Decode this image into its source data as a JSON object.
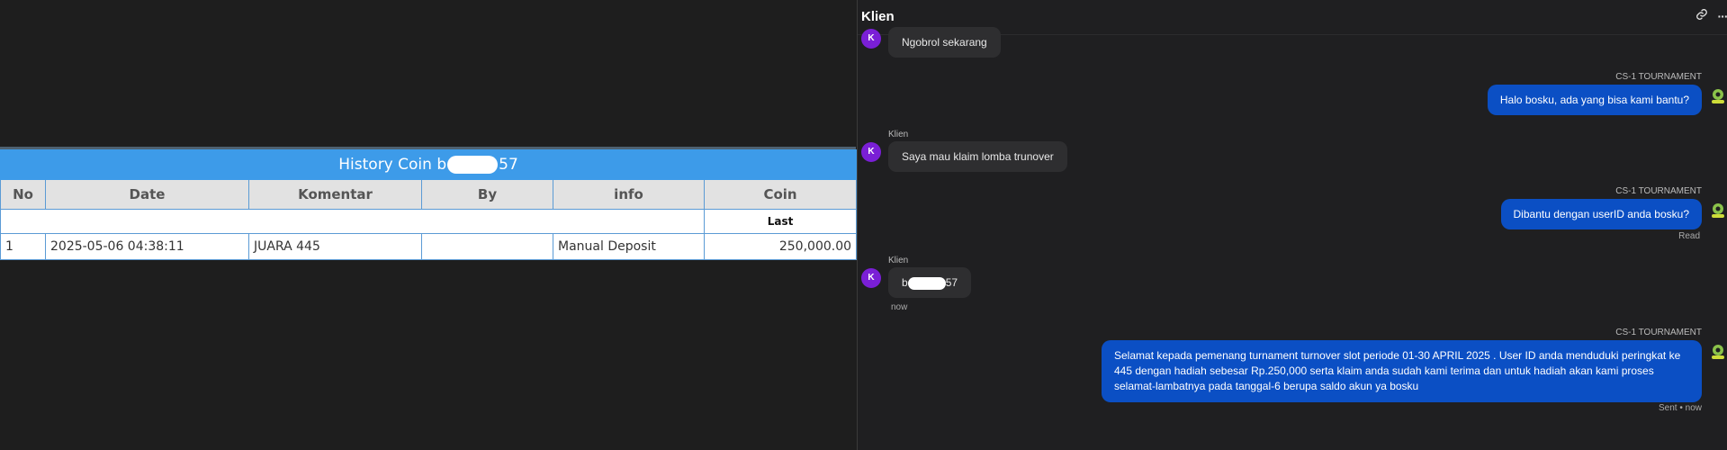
{
  "history": {
    "title_prefix": "History Coin b",
    "title_suffix": "57",
    "columns": [
      "No",
      "Date",
      "Komentar",
      "By",
      "info",
      "Coin"
    ],
    "subheader_coin": "Last",
    "rows": [
      {
        "no": "1",
        "date": "2025-05-06 04:38:11",
        "komentar": "JUARA 445",
        "by": "",
        "info": "Manual Deposit",
        "coin": "250,000.00"
      }
    ]
  },
  "chat": {
    "title": "Klien",
    "header_icons": [
      "link-icon",
      "more-icon"
    ],
    "avatar_letter": "K",
    "messages": [
      {
        "side": "in",
        "text": "Ngobrol sekarang"
      },
      {
        "side": "out",
        "sender": "CS-1 TOURNAMENT",
        "text": "Halo bosku, ada yang bisa kami bantu?"
      },
      {
        "side": "in",
        "sender": "Klien",
        "text": "Saya mau klaim lomba trunover"
      },
      {
        "side": "out",
        "sender": "CS-1 TOURNAMENT",
        "text": "Dibantu dengan userID anda bosku?",
        "status": "Read"
      },
      {
        "side": "in",
        "sender": "Klien",
        "text_prefix": "b",
        "text_suffix": "57",
        "status": "now"
      },
      {
        "side": "out",
        "sender": "CS-1 TOURNAMENT",
        "text": "Selamat kepada pemenang turnament turnover slot periode 01-30 APRIL 2025 . User ID anda menduduki peringkat ke 445 dengan hadiah sebesar Rp.250,000 serta klaim anda sudah kami terima dan untuk hadiah akan kami proses selamat-lambatnya pada tanggal-6 berupa saldo akun ya bosku",
        "status": "Sent • now"
      }
    ]
  },
  "colors": {
    "table_title_bg": "#3d9be9",
    "coin_value": "#2e8b2e",
    "out_bubble": "#0b4fc4",
    "avatar": "#7a1fd6"
  }
}
